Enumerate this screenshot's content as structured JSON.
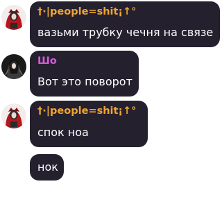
{
  "colors": {
    "bubble_bg": "#24202e",
    "sender_orange": "#f0a531",
    "sender_purple": "#d65ad8",
    "message_text": "#ffffff",
    "background": "#ffffff"
  },
  "messages": [
    {
      "sender": "†·|people=shit¡↑°",
      "sender_color": "orange",
      "text": "вазьми трубку чечня на связе",
      "avatar": "red-hooded-figure"
    },
    {
      "sender": "Шо",
      "sender_color": "purple",
      "text": "Вот это поворот",
      "avatar": "dark-long-hair-figure"
    },
    {
      "sender": "†·|people=shit¡↑°",
      "sender_color": "orange",
      "text": "спок ноа",
      "avatar": "red-hooded-figure"
    },
    {
      "text": "нок"
    }
  ]
}
